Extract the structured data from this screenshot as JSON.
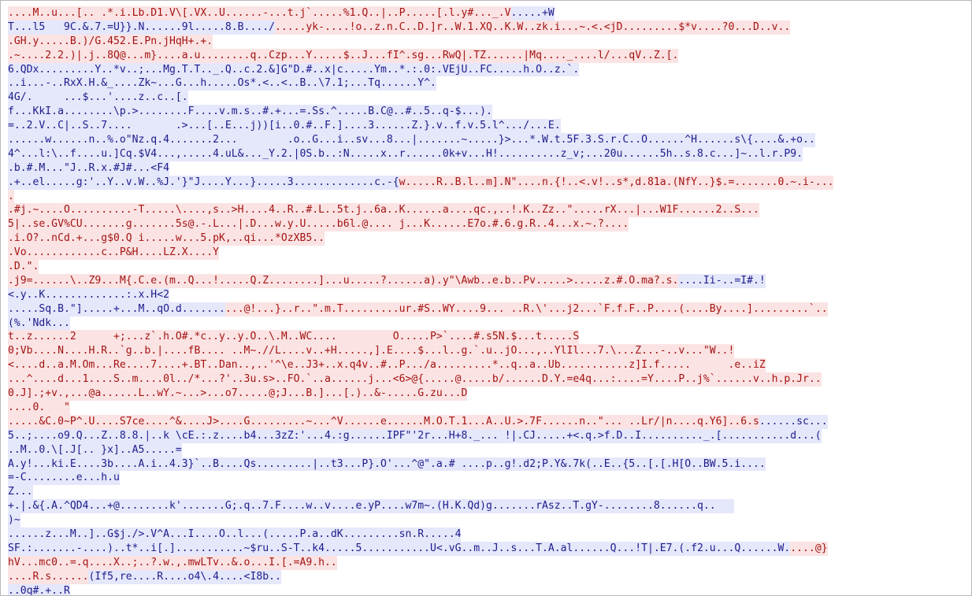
{
  "app": {
    "title": ""
  },
  "colors": {
    "deleted_fg": "#a41313",
    "deleted_bg": "#fbe3e3",
    "inserted_fg": "#1c1c8a",
    "inserted_bg": "#e5e7fb",
    "background": "#ffffff",
    "border": "#b8b8b8"
  },
  "lines": [
    [
      {
        "t": "....M..u...[.. .*.i.Lb.D1.V\\[.VX..U......-...t.j`.....%1.Q..|..P.....[.l.y#..._.V",
        "c": "red"
      },
      {
        "t": ".....+W",
        "c": "blue"
      }
    ],
    [
      {
        "t": "T...l5   9C.&.7.=U}}.N......9l.....8.B..../",
        "c": "blue"
      },
      {
        "t": ".....yk-....!o..z.n.C..D.]r..W.1.XQ..K.W..zk.i...~.<.<jD.........$*v....?0...D..v..",
        "c": "red"
      }
    ],
    [
      {
        "t": ".GH.y.....B.)/G.452.E.Pn.jHqH+.+.",
        "c": "red"
      }
    ],
    [
      {
        "t": ".~....2.2.)|.j..8Q@...m}....a.u........q..Czp...Y.....$..J...fI^.sg...RwQ|.TZ......|Mq...._....l/...qV..Z.[.",
        "c": "red"
      }
    ],
    [
      {
        "t": "6.QDx.........Y..*v..;...Mg.T.T.._.Q..c.2.&]G\"D.#..x|c.....Ym..*.:.0:.VEjU..FC.....h.O..z.`.",
        "c": "blue"
      }
    ],
    [
      {
        "t": "..i...-..RxX.H.&_....Zk~...G...h.....Os*.<..<..B..\\7.1;...Tq......Y^.",
        "c": "blue"
      }
    ],
    [
      {
        "t": "4G/.     ...$...'....z..c..[.",
        "c": "blue"
      }
    ],
    [
      {
        "t": "f...KkI.a........\\p.>........F....v.m.s..#.+...=.Ss.^.....B.C@..#..5..q-$...).",
        "c": "blue"
      }
    ],
    [
      {
        "t": "=..2.V..C|..S..7....       .>...[..E...j))[i..0.#..F.]....3......Z.}.v..f.v.5.l^.../...E.",
        "c": "blue"
      }
    ],
    [
      {
        "t": "......w......n..%.o\"Nz.q.4.......2...        .o..G...i..sv...8...|.......~.....}>...*.W.t.5F.3.S.r.C..O......^H......s\\{....&.+o..",
        "c": "blue"
      }
    ],
    [
      {
        "t": "4^...l:\\..f....u.]Cq.$V4...,.....4.uL&..._Y.2.|0S.b..:N.....x..r......0k+v...H!..........z_v;...20u......5h..s.8.c...]~..l.r.P9.",
        "c": "blue"
      }
    ],
    [
      {
        "t": ".b.#.M...\"J..R.x.#J#...<F4",
        "c": "blue"
      }
    ],
    [
      {
        "t": ".+..el.....g:'..Y..v.W..%J.'}\"J....Y...}.....3.............c.-{",
        "c": "blue"
      },
      {
        "t": "w.....R..B.l..m].N\"....n.{!..<.v!..s*,d.81a.(NfY..}$.=.......0.~.i-...",
        "c": "red"
      }
    ],
    [
      {
        "t": ".",
        "c": "red"
      }
    ],
    [
      {
        "t": ".#j.~....O..........-T.....\\....,s..>H....4..R..#.L..5t.j..6a..K.",
        "c": "red"
      },
      {
        "t": ".....a....qc.,..!.K..Zz..\".....rX...|...W1F......2..S...",
        "c": "red"
      }
    ],
    [
      {
        "t": "5|..se.GV%CU.......g.......5s@.-.L...|.D...w.y.U.....b6l.@.... j...K......E7o.#.6.g.R..4...x.~.?....",
        "c": "red"
      }
    ],
    [
      {
        "t": ".i.O?..nCd.+...g$0.Q i.....w...5.pK,..qi...*OzXB5..",
        "c": "red"
      }
    ],
    [
      {
        "t": ".Vo............c..P&H....LZ.X....Y",
        "c": "red"
      }
    ],
    [
      {
        "t": ".D.\".",
        "c": "red"
      }
    ],
    [
      {
        "t": ".j9=......\\..Z9...M{.C.e.(m..Q...!.....Q.Z........]...u.....?......a).y\"\\Awb..e.b..Pv.....>.....z.#.O.ma?.s.",
        "c": "red"
      },
      {
        "t": "....Ii-..=I#.!",
        "c": "blue"
      }
    ],
    [
      {
        "t": "<.y..K.............:.x.H<2",
        "c": "blue"
      }
    ],
    [
      {
        "t": ".....Sq.B.\"].....+...M..qO.d.......",
        "c": "blue"
      },
      {
        "t": "...@!...}..r..\".m.T.........ur.#S..WY....9... ..R.\\'...j2...`F.f.F..P....(....By....].........`..",
        "c": "red"
      }
    ],
    [
      {
        "t": "(%.'Ndk...",
        "c": "blue"
      }
    ],
    [
      {
        "t": "t..z......2      +;...z`.h.O#.*c..y..y.O..\\.M..WC....         O.....P>`....#.s5N.$...t.....S",
        "c": "red"
      }
    ],
    [
      {
        "t": "0;Vb....N....H.R..`g..b.|....fB.... ..M~.//L....v..+H.....,].E....$...l..g.`.u..jO...,..YlIl...7.\\...Z...-..v...\"W..!",
        "c": "red"
      }
    ],
    [
      {
        "t": "<....d..a.M.Om...Re....7....+.BT..Dan..,..'^\\e..J3+..x.q4v..#..P.../a.........*..q..a..Ub...........z]I.f.....      .e..iZ",
        "c": "red"
      }
    ],
    [
      {
        "t": "...^....d...1....S..m....0l../*...?'..3u.s>..FO.`..a......j...<6>@{.....@.....b/......D.Y.=e4q...:....=Y....P..j%`......v..h.p.Jr..",
        "c": "red"
      }
    ],
    [
      {
        "t": "0.J].;+v.,...@a......L..wY.~...>...o7.....@;J...B.]...[.)..&-.....G.zu...D",
        "c": "red"
      }
    ],
    [
      {
        "t": "....0.   \"",
        "c": "red"
      }
    ],
    [
      {
        "t": ".....&C.0~P^.U....S7ce....^&....J>....G.........~...^V......e......M.O.T.1...A..U.>.7F......n..\"... ..Lr/|n....q.Y6]..6.s",
        "c": "red"
      },
      {
        "t": "......sc...",
        "c": "blue"
      }
    ],
    [
      {
        "t": "5..;....o9.Q...Z..8.8.|..k \\cE.:.z....b4...3zZ:'...4.:g......IPF\"'2r...H+8._... !|.CJ.....+<.q.>f.D..I.........._.[...........d...(",
        "c": "blue"
      }
    ],
    [
      {
        "t": "..M..0.\\[.J[.. }x]..A5.....=",
        "c": "blue"
      }
    ],
    [
      {
        "t": "A.y!...ki.E....3b....A.i..4.3}`..B....Qs.........|..t3...P}.O'...^@\".a.# ....p..g!.d2;P.Y&.7k(..E..{5..[.[.H[O..BW.5.i....",
        "c": "blue"
      }
    ],
    [
      {
        "t": "=-C........e...h.u",
        "c": "blue"
      }
    ],
    [
      {
        "t": "Z...",
        "c": "blue"
      }
    ],
    [
      {
        "t": "+.|.&{.A.^QD4...+@........k'.......G;.q..7.F....w..v....e.yP....w7m~.(H.K.Qd)g.......rAsz..T.gY-........8......q..   ",
        "c": "blue"
      }
    ],
    [
      {
        "t": ")~",
        "c": "blue"
      }
    ],
    [
      {
        "t": "......z...M..]..G$j./>.V^A...I....O..l...(.....P.a..dK.........sn.R.....4",
        "c": "blue"
      }
    ],
    [
      {
        "t": "SF.:.......-....)..t*..i[.]...........~$ru..S-T..k4.....5...........U<.vG..m..J..s...T.A.al......Q...!T|.E7.(.f2.u...Q......W.",
        "c": "blue"
      },
      {
        "t": "....@}",
        "c": "red"
      }
    ],
    [
      {
        "t": "hV...mc0..=.q....X..;..?.w.,.mwLTv..&.o...I.[.=A9.h..",
        "c": "red"
      }
    ],
    [
      {
        "t": "....R.s......",
        "c": "red"
      },
      {
        "t": "(If5,re....R....o4\\.4....<I8b..",
        "c": "blue"
      }
    ],
    [
      {
        "t": "..0q#.+..R",
        "c": "blue"
      }
    ]
  ]
}
